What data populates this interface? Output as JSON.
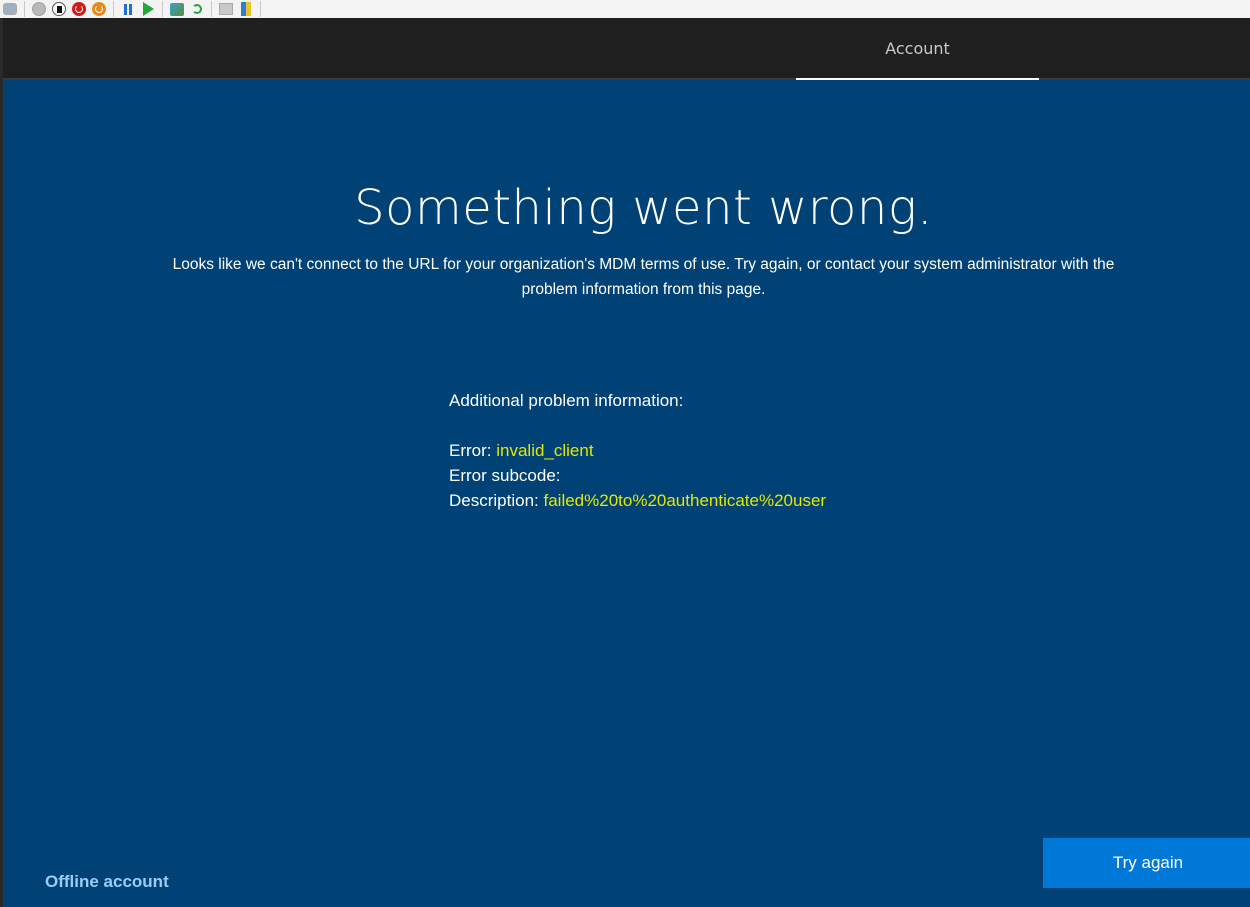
{
  "vm_toolbar": {
    "buttons": [
      {
        "icon": "keyboard-ctrl-alt-del-icon"
      },
      {
        "icon": "start-icon"
      },
      {
        "icon": "turn-off-icon"
      },
      {
        "icon": "shut-down-icon"
      },
      {
        "icon": "save-state-icon"
      },
      {
        "icon": "pause-icon"
      },
      {
        "icon": "resume-icon"
      },
      {
        "icon": "checkpoint-icon"
      },
      {
        "icon": "revert-icon"
      },
      {
        "icon": "enhanced-session-icon"
      },
      {
        "icon": "share-icon"
      }
    ]
  },
  "header": {
    "tab_label": "Account"
  },
  "main": {
    "title": "Something went wrong.",
    "message_line1": "Looks like we can't connect to the URL for your organization's MDM terms of use. Try again, or contact your system administrator with the",
    "message_line2": "problem information from this page.",
    "details_heading": "Additional problem information:",
    "error_label": "Error: ",
    "error_value": "invalid_client",
    "subcode_label": "Error subcode:",
    "subcode_value": "",
    "description_label": "Description: ",
    "description_value": "failed%20to%20authenticate%20user"
  },
  "footer": {
    "offline_account_label": "Offline account",
    "try_again_label": "Try again"
  },
  "colors": {
    "background": "#004275",
    "header": "#1f1f1f",
    "highlight": "#e3e800",
    "link": "#99ccf7",
    "primary_button": "#0078d7"
  }
}
